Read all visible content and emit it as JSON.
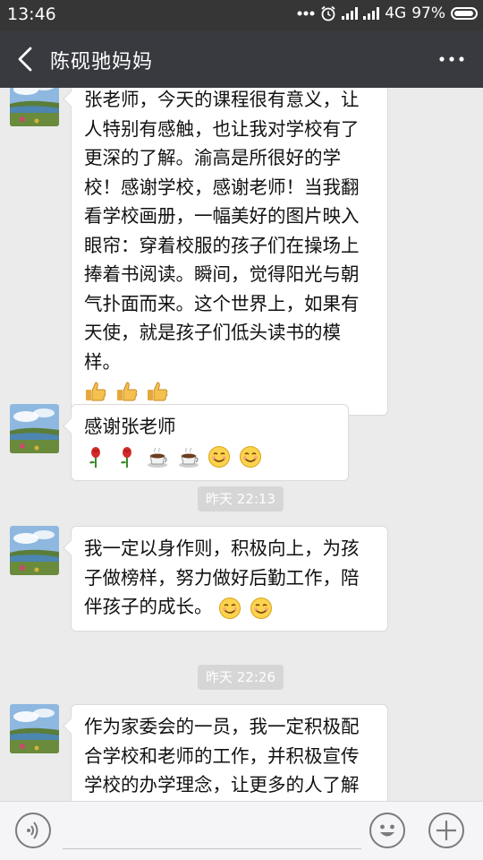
{
  "status_bar": {
    "time": "13:46",
    "network": "4G",
    "battery": "97%"
  },
  "header": {
    "title": "陈砚驰妈妈",
    "back_icon": "chevron-left-icon",
    "more_icon": "more-dots-icon"
  },
  "messages": [
    {
      "type": "received",
      "text": "张老师，今天的课程很有意义，让人特别有感触，也让我对学校有了更深的了解。渝高是所很好的学校！感谢学校，感谢老师！当我翻看学校画册，一幅美好的图片映入眼帘：穿着校服的孩子们在操场上捧着书阅读。瞬间，觉得阳光与朝气扑面而来。这个世界上，如果有天使，就是孩子们低头读书的模样。",
      "emojis": [
        "thumbs-up",
        "thumbs-up",
        "thumbs-up"
      ]
    },
    {
      "type": "received",
      "text": "感谢张老师",
      "emojis": [
        "rose",
        "rose",
        "coffee",
        "coffee",
        "smile",
        "smile"
      ]
    },
    {
      "type": "timestamp",
      "text": "昨天 22:13"
    },
    {
      "type": "received",
      "text": "我一定以身作则，积极向上，为孩子做榜样，努力做好后勤工作，陪伴孩子的成长。",
      "emojis": [
        "smile",
        "smile"
      ]
    },
    {
      "type": "timestamp",
      "text": "昨天 22:26"
    },
    {
      "type": "received",
      "text": "作为家委会的一员，我一定积极配合学校和老师的工作，并积极宣传学校的办学理念，让更多的人了解",
      "emojis": []
    }
  ],
  "input_bar": {
    "voice_icon": "voice-icon",
    "emoji_icon": "emoji-icon",
    "plus_icon": "plus-icon"
  },
  "colors": {
    "status_bar_bg": "#363636",
    "title_bar_bg": "#393a3f",
    "chat_bg": "#ebebeb",
    "timestamp_bg": "#d6d6d6"
  }
}
